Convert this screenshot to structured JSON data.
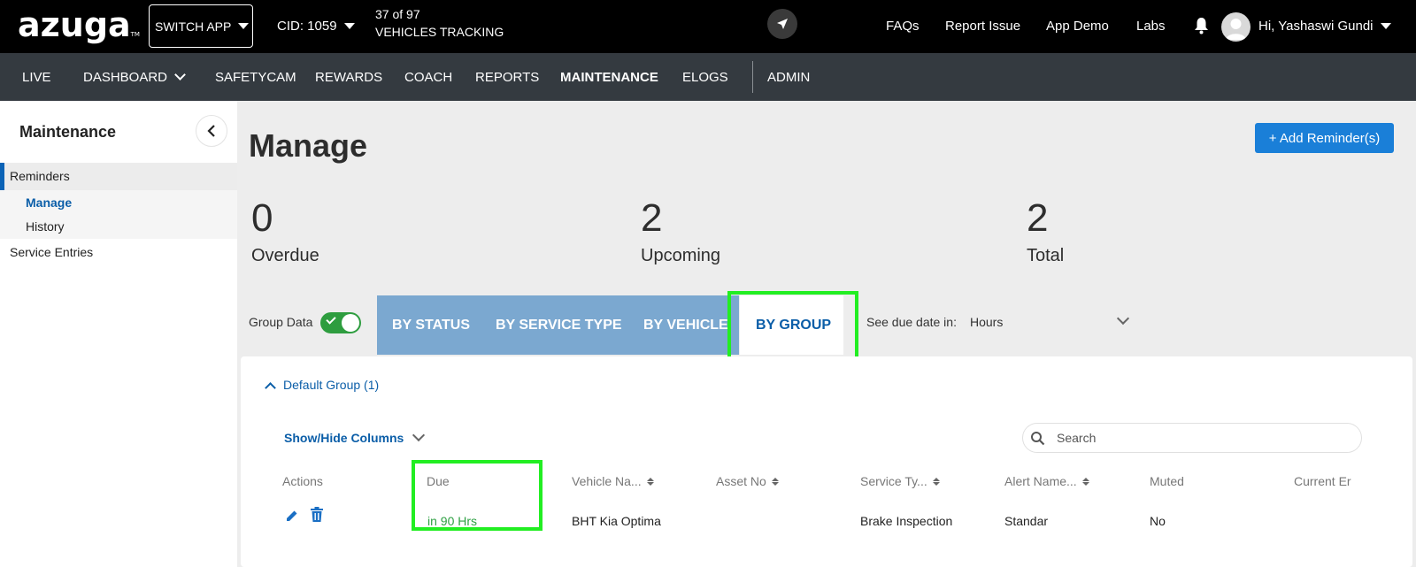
{
  "topbar": {
    "logo": "azuga",
    "logo_tm": "TM",
    "switch_app": "SWITCH APP",
    "cid": "CID: 1059",
    "vehicles_count": "37 of 97",
    "vehicles_label": "VEHICLES TRACKING",
    "links": [
      "FAQs",
      "Report Issue",
      "App Demo",
      "Labs"
    ],
    "greeting": "Hi, Yashaswi Gundi"
  },
  "mainnav": {
    "items": [
      "LIVE",
      "DASHBOARD",
      "SAFETYCAM",
      "REWARDS",
      "COACH",
      "REPORTS",
      "MAINTENANCE",
      "ELOGS",
      "ADMIN"
    ],
    "active": "MAINTENANCE"
  },
  "sidebar": {
    "title": "Maintenance",
    "reminders": "Reminders",
    "manage": "Manage",
    "history": "History",
    "service_entries": "Service Entries"
  },
  "main": {
    "title": "Manage",
    "add_button": "+ Add Reminder(s)",
    "stats": [
      {
        "value": "0",
        "label": "Overdue"
      },
      {
        "value": "2",
        "label": "Upcoming"
      },
      {
        "value": "2",
        "label": "Total"
      }
    ],
    "group_data_label": "Group Data",
    "group_data_on": true,
    "tabs": [
      "BY STATUS",
      "BY SERVICE TYPE",
      "BY VEHICLE",
      "BY GROUP"
    ],
    "active_tab": "BY GROUP",
    "due_date_label": "See due date in:",
    "due_date_value": "Hours"
  },
  "panel": {
    "group_title": "Default Group (1)",
    "show_hide": "Show/Hide Columns",
    "search_placeholder": "Search",
    "columns": [
      "Actions",
      "Due",
      "Vehicle Na...",
      "Asset No",
      "Service Ty...",
      "Alert Name...",
      "Muted",
      "Current Er"
    ],
    "rows": [
      {
        "due": "in 90 Hrs",
        "vehicle": "BHT Kia Optima",
        "asset": "",
        "service": "Brake Inspection",
        "alert": "Standar",
        "muted": "No"
      }
    ]
  },
  "colors": {
    "accent": "#0b5ea8",
    "button": "#1a7fd8",
    "highlight": "#22ee22",
    "due": "#2ea043"
  }
}
